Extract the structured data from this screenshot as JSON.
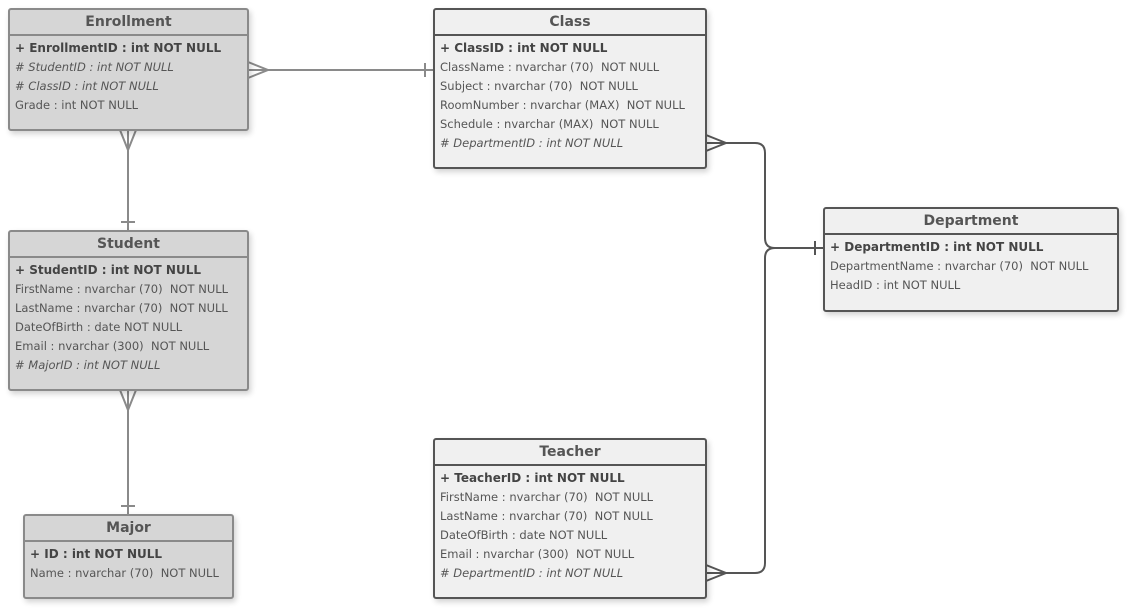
{
  "entities": {
    "enrollment": {
      "title": "Enrollment",
      "rows": [
        {
          "text": "+ EnrollmentID : int NOT NULL",
          "kind": "pk"
        },
        {
          "text": "# StudentID : int NOT NULL",
          "kind": "fk"
        },
        {
          "text": "# ClassID : int NOT NULL",
          "kind": "fk"
        },
        {
          "text": "Grade : int NOT NULL",
          "kind": ""
        }
      ]
    },
    "class": {
      "title": "Class",
      "rows": [
        {
          "text": "+ ClassID : int NOT NULL",
          "kind": "pk"
        },
        {
          "text": "ClassName : nvarchar (70)  NOT NULL",
          "kind": ""
        },
        {
          "text": "Subject : nvarchar (70)  NOT NULL",
          "kind": ""
        },
        {
          "text": "RoomNumber : nvarchar (MAX)  NOT NULL",
          "kind": ""
        },
        {
          "text": "Schedule : nvarchar (MAX)  NOT NULL",
          "kind": ""
        },
        {
          "text": "# DepartmentID : int NOT NULL",
          "kind": "fk"
        }
      ]
    },
    "student": {
      "title": "Student",
      "rows": [
        {
          "text": "+ StudentID : int NOT NULL",
          "kind": "pk"
        },
        {
          "text": "FirstName : nvarchar (70)  NOT NULL",
          "kind": ""
        },
        {
          "text": "LastName : nvarchar (70)  NOT NULL",
          "kind": ""
        },
        {
          "text": "DateOfBirth : date NOT NULL",
          "kind": ""
        },
        {
          "text": "Email : nvarchar (300)  NOT NULL",
          "kind": ""
        },
        {
          "text": "# MajorID : int NOT NULL",
          "kind": "fk"
        }
      ]
    },
    "department": {
      "title": "Department",
      "rows": [
        {
          "text": "+ DepartmentID : int NOT NULL",
          "kind": "pk"
        },
        {
          "text": "DepartmentName : nvarchar (70)  NOT NULL",
          "kind": ""
        },
        {
          "text": "HeadID : int NOT NULL",
          "kind": ""
        }
      ]
    },
    "major": {
      "title": "Major",
      "rows": [
        {
          "text": "+ ID : int NOT NULL",
          "kind": "pk"
        },
        {
          "text": "Name : nvarchar (70)  NOT NULL",
          "kind": ""
        }
      ]
    },
    "teacher": {
      "title": "Teacher",
      "rows": [
        {
          "text": "+ TeacherID : int NOT NULL",
          "kind": "pk"
        },
        {
          "text": "FirstName : nvarchar (70)  NOT NULL",
          "kind": ""
        },
        {
          "text": "LastName : nvarchar (70)  NOT NULL",
          "kind": ""
        },
        {
          "text": "DateOfBirth : date NOT NULL",
          "kind": ""
        },
        {
          "text": "Email : nvarchar (300)  NOT NULL",
          "kind": ""
        },
        {
          "text": "# DepartmentID : int NOT NULL",
          "kind": "fk"
        }
      ]
    }
  },
  "relationships": [
    {
      "from": "Enrollment",
      "to": "Class",
      "cardinality": "many-to-one"
    },
    {
      "from": "Enrollment",
      "to": "Student",
      "cardinality": "many-to-one"
    },
    {
      "from": "Student",
      "to": "Major",
      "cardinality": "many-to-one"
    },
    {
      "from": "Class",
      "to": "Department",
      "cardinality": "many-to-one"
    },
    {
      "from": "Teacher",
      "to": "Department",
      "cardinality": "many-to-one"
    }
  ]
}
